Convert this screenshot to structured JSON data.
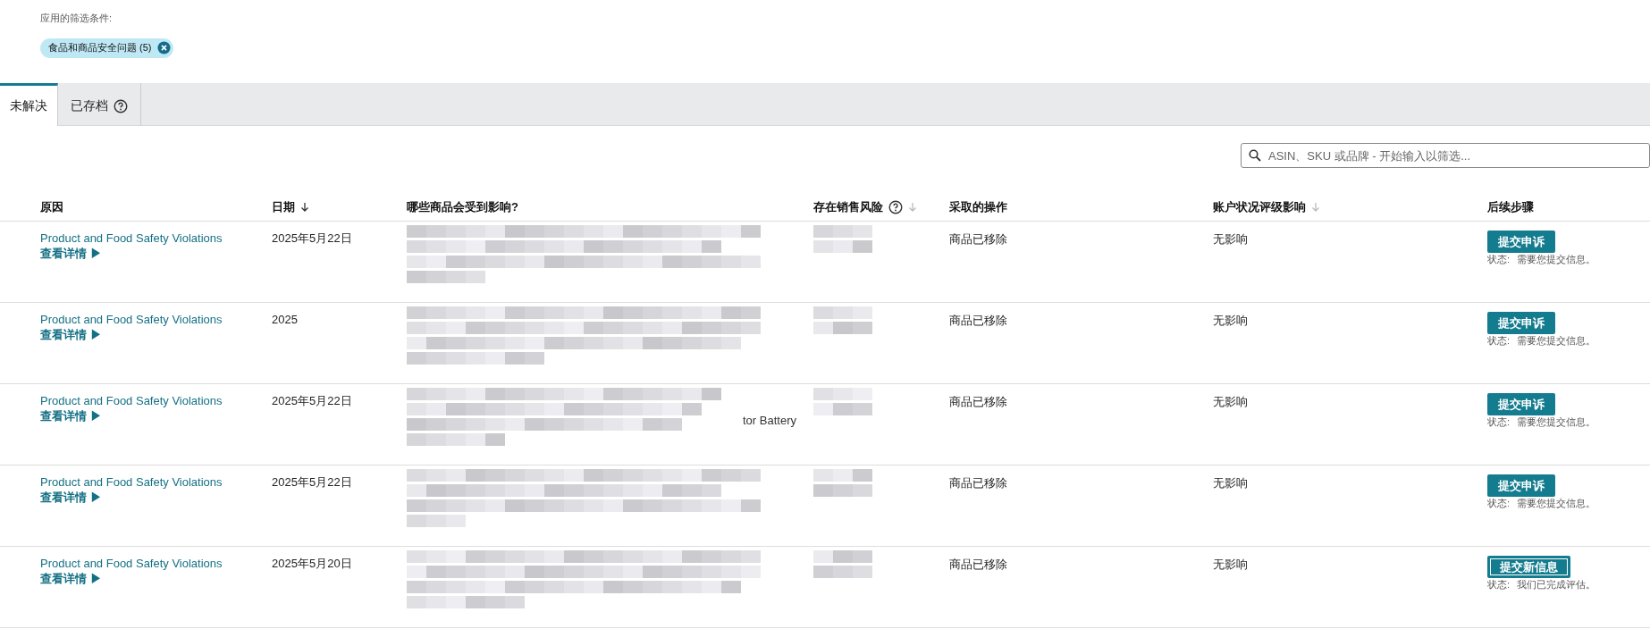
{
  "filters": {
    "label": "应用的筛选条件:",
    "chips": [
      {
        "label": "食品和商品安全问题 (5)"
      }
    ]
  },
  "tabs": [
    {
      "label": "未解决",
      "selected": true,
      "help": false
    },
    {
      "label": "已存档",
      "selected": false,
      "help": true
    }
  ],
  "search": {
    "placeholder": "ASIN、SKU 或品牌 - 开始输入以筛选..."
  },
  "table": {
    "columns": [
      {
        "label": "原因",
        "sort": false,
        "help": false
      },
      {
        "label": "日期",
        "sort": true,
        "sort_active": true,
        "help": false
      },
      {
        "label": "哪些商品会受到影响?",
        "sort": false,
        "help": false
      },
      {
        "label": "存在销售风险",
        "sort": true,
        "sort_active": false,
        "help": true
      },
      {
        "label": "采取的操作",
        "sort": false,
        "help": false
      },
      {
        "label": "账户状况评级影响",
        "sort": true,
        "sort_active": false,
        "help": false
      },
      {
        "label": "后续步骤",
        "sort": false,
        "help": false
      }
    ],
    "rows": [
      {
        "reason": "Product and Food Safety Violations",
        "details": "查看详情 ▶",
        "date": "2025年5月22日",
        "products_fragment": null,
        "action": "商品已移除",
        "impact": "无影响",
        "button": {
          "label": "提交申诉",
          "kind": "primary"
        },
        "status_label": "状态:",
        "status": "需要您提交信息。"
      },
      {
        "reason": "Product and Food Safety Violations",
        "details": "查看详情 ▶",
        "date": "2025",
        "products_fragment": null,
        "action": "商品已移除",
        "impact": "无影响",
        "button": {
          "label": "提交申诉",
          "kind": "primary"
        },
        "status_label": "状态:",
        "status": "需要您提交信息。"
      },
      {
        "reason": "Product and Food Safety Violations",
        "details": "查看详情 ▶",
        "date": "2025年5月22日",
        "products_fragment": "tor Battery",
        "action": "商品已移除",
        "impact": "无影响",
        "button": {
          "label": "提交申诉",
          "kind": "primary"
        },
        "status_label": "状态:",
        "status": "需要您提交信息。"
      },
      {
        "reason": "Product and Food Safety Violations",
        "details": "查看详情 ▶",
        "date": "2025年5月22日",
        "products_fragment": null,
        "action": "商品已移除",
        "impact": "无影响",
        "button": {
          "label": "提交申诉",
          "kind": "primary"
        },
        "status_label": "状态:",
        "status": "需要您提交信息。"
      },
      {
        "reason": "Product and Food Safety Violations",
        "details": "查看详情 ▶",
        "date": "2025年5月20日",
        "products_fragment": null,
        "action": "商品已移除",
        "impact": "无影响",
        "button": {
          "label": "提交新信息",
          "kind": "outlined"
        },
        "status_label": "状态:",
        "status": "我们已完成评估。"
      }
    ]
  }
}
